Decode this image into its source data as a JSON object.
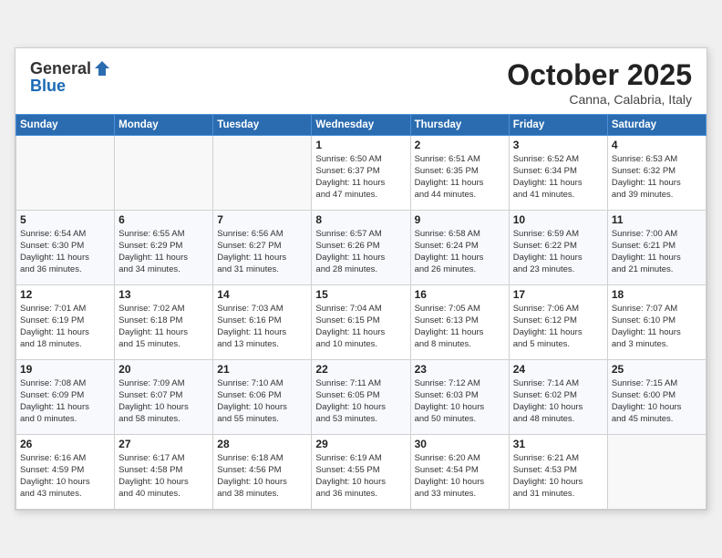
{
  "header": {
    "logo_general": "General",
    "logo_blue": "Blue",
    "month_title": "October 2025",
    "subtitle": "Canna, Calabria, Italy"
  },
  "weekdays": [
    "Sunday",
    "Monday",
    "Tuesday",
    "Wednesday",
    "Thursday",
    "Friday",
    "Saturday"
  ],
  "weeks": [
    [
      {
        "day": "",
        "info": ""
      },
      {
        "day": "",
        "info": ""
      },
      {
        "day": "",
        "info": ""
      },
      {
        "day": "1",
        "info": "Sunrise: 6:50 AM\nSunset: 6:37 PM\nDaylight: 11 hours\nand 47 minutes."
      },
      {
        "day": "2",
        "info": "Sunrise: 6:51 AM\nSunset: 6:35 PM\nDaylight: 11 hours\nand 44 minutes."
      },
      {
        "day": "3",
        "info": "Sunrise: 6:52 AM\nSunset: 6:34 PM\nDaylight: 11 hours\nand 41 minutes."
      },
      {
        "day": "4",
        "info": "Sunrise: 6:53 AM\nSunset: 6:32 PM\nDaylight: 11 hours\nand 39 minutes."
      }
    ],
    [
      {
        "day": "5",
        "info": "Sunrise: 6:54 AM\nSunset: 6:30 PM\nDaylight: 11 hours\nand 36 minutes."
      },
      {
        "day": "6",
        "info": "Sunrise: 6:55 AM\nSunset: 6:29 PM\nDaylight: 11 hours\nand 34 minutes."
      },
      {
        "day": "7",
        "info": "Sunrise: 6:56 AM\nSunset: 6:27 PM\nDaylight: 11 hours\nand 31 minutes."
      },
      {
        "day": "8",
        "info": "Sunrise: 6:57 AM\nSunset: 6:26 PM\nDaylight: 11 hours\nand 28 minutes."
      },
      {
        "day": "9",
        "info": "Sunrise: 6:58 AM\nSunset: 6:24 PM\nDaylight: 11 hours\nand 26 minutes."
      },
      {
        "day": "10",
        "info": "Sunrise: 6:59 AM\nSunset: 6:22 PM\nDaylight: 11 hours\nand 23 minutes."
      },
      {
        "day": "11",
        "info": "Sunrise: 7:00 AM\nSunset: 6:21 PM\nDaylight: 11 hours\nand 21 minutes."
      }
    ],
    [
      {
        "day": "12",
        "info": "Sunrise: 7:01 AM\nSunset: 6:19 PM\nDaylight: 11 hours\nand 18 minutes."
      },
      {
        "day": "13",
        "info": "Sunrise: 7:02 AM\nSunset: 6:18 PM\nDaylight: 11 hours\nand 15 minutes."
      },
      {
        "day": "14",
        "info": "Sunrise: 7:03 AM\nSunset: 6:16 PM\nDaylight: 11 hours\nand 13 minutes."
      },
      {
        "day": "15",
        "info": "Sunrise: 7:04 AM\nSunset: 6:15 PM\nDaylight: 11 hours\nand 10 minutes."
      },
      {
        "day": "16",
        "info": "Sunrise: 7:05 AM\nSunset: 6:13 PM\nDaylight: 11 hours\nand 8 minutes."
      },
      {
        "day": "17",
        "info": "Sunrise: 7:06 AM\nSunset: 6:12 PM\nDaylight: 11 hours\nand 5 minutes."
      },
      {
        "day": "18",
        "info": "Sunrise: 7:07 AM\nSunset: 6:10 PM\nDaylight: 11 hours\nand 3 minutes."
      }
    ],
    [
      {
        "day": "19",
        "info": "Sunrise: 7:08 AM\nSunset: 6:09 PM\nDaylight: 11 hours\nand 0 minutes."
      },
      {
        "day": "20",
        "info": "Sunrise: 7:09 AM\nSunset: 6:07 PM\nDaylight: 10 hours\nand 58 minutes."
      },
      {
        "day": "21",
        "info": "Sunrise: 7:10 AM\nSunset: 6:06 PM\nDaylight: 10 hours\nand 55 minutes."
      },
      {
        "day": "22",
        "info": "Sunrise: 7:11 AM\nSunset: 6:05 PM\nDaylight: 10 hours\nand 53 minutes."
      },
      {
        "day": "23",
        "info": "Sunrise: 7:12 AM\nSunset: 6:03 PM\nDaylight: 10 hours\nand 50 minutes."
      },
      {
        "day": "24",
        "info": "Sunrise: 7:14 AM\nSunset: 6:02 PM\nDaylight: 10 hours\nand 48 minutes."
      },
      {
        "day": "25",
        "info": "Sunrise: 7:15 AM\nSunset: 6:00 PM\nDaylight: 10 hours\nand 45 minutes."
      }
    ],
    [
      {
        "day": "26",
        "info": "Sunrise: 6:16 AM\nSunset: 4:59 PM\nDaylight: 10 hours\nand 43 minutes."
      },
      {
        "day": "27",
        "info": "Sunrise: 6:17 AM\nSunset: 4:58 PM\nDaylight: 10 hours\nand 40 minutes."
      },
      {
        "day": "28",
        "info": "Sunrise: 6:18 AM\nSunset: 4:56 PM\nDaylight: 10 hours\nand 38 minutes."
      },
      {
        "day": "29",
        "info": "Sunrise: 6:19 AM\nSunset: 4:55 PM\nDaylight: 10 hours\nand 36 minutes."
      },
      {
        "day": "30",
        "info": "Sunrise: 6:20 AM\nSunset: 4:54 PM\nDaylight: 10 hours\nand 33 minutes."
      },
      {
        "day": "31",
        "info": "Sunrise: 6:21 AM\nSunset: 4:53 PM\nDaylight: 10 hours\nand 31 minutes."
      },
      {
        "day": "",
        "info": ""
      }
    ]
  ]
}
